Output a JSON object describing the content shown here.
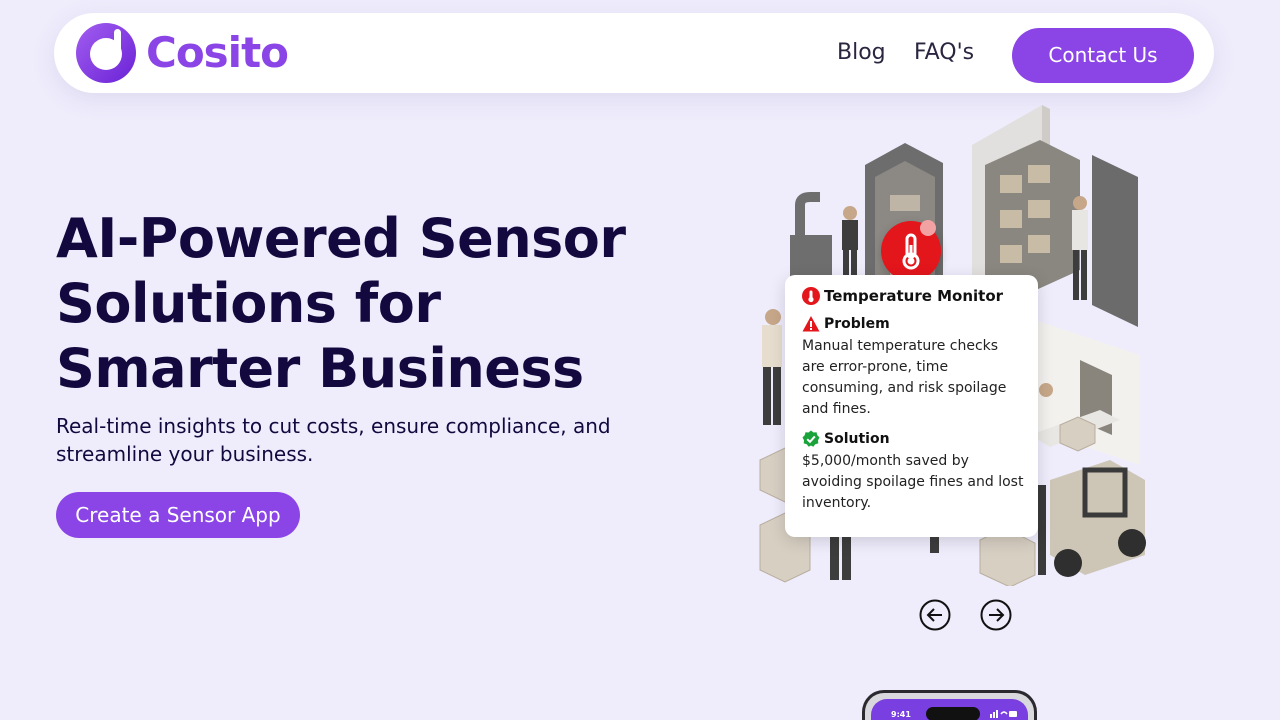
{
  "brand": {
    "name": "Cosito",
    "accent_color": "#8b45e6"
  },
  "nav": {
    "links": [
      {
        "label": "Blog"
      },
      {
        "label": "FAQ's"
      }
    ],
    "contact_label": "Contact Us"
  },
  "hero": {
    "title": "AI-Powered Sensor Solutions for Smarter Business",
    "subtitle": "Real-time insights to cut costs, ensure compliance, and streamline your business.",
    "cta_label": "Create a Sensor App"
  },
  "showcase": {
    "card": {
      "title": "Temperature Monitor",
      "problem_heading": "Problem",
      "problem_text": "Manual temperature checks are error-prone, time consuming, and risk spoilage and fines.",
      "solution_heading": "Solution",
      "solution_text": "$5,000/month saved by avoiding spoilage fines and lost inventory."
    },
    "icons": {
      "badge": "thermometer-icon",
      "problem": "warning-icon",
      "solution": "verified-check-icon",
      "prev": "arrow-left-circle-icon",
      "next": "arrow-right-circle-icon"
    }
  },
  "phone_preview": {
    "time": "9:41"
  }
}
